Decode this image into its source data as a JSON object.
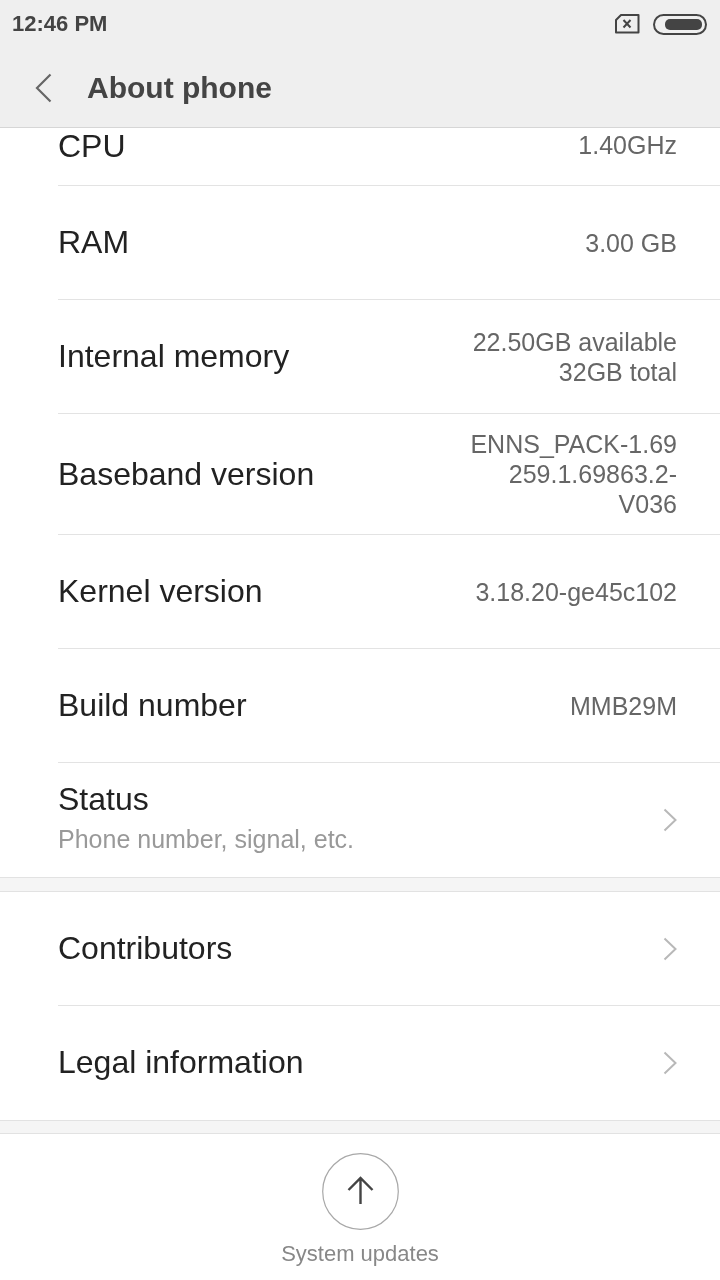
{
  "status_bar": {
    "time": "12:46 PM"
  },
  "header": {
    "title": "About phone"
  },
  "sections": [
    {
      "items": [
        {
          "kind": "clipped",
          "label": "CPU",
          "value": "1.40GHz"
        },
        {
          "kind": "info",
          "label": "RAM",
          "value": "3.00 GB"
        },
        {
          "kind": "info",
          "label": "Internal memory",
          "value": "22.50GB available\n32GB total"
        },
        {
          "kind": "info",
          "label": "Baseband version",
          "value": "ENNS_PACK-1.69\n259.1.69863.2-\nV036"
        },
        {
          "kind": "info",
          "label": "Kernel version",
          "value": "3.18.20-ge45c102"
        },
        {
          "kind": "info",
          "label": "Build number",
          "value": "MMB29M"
        },
        {
          "kind": "link",
          "label": "Status",
          "subtitle": "Phone number, signal, etc."
        }
      ]
    },
    {
      "items": [
        {
          "kind": "link",
          "label": "Contributors"
        },
        {
          "kind": "link",
          "label": "Legal information"
        }
      ]
    }
  ],
  "footer": {
    "button": {
      "label": "System updates"
    }
  }
}
